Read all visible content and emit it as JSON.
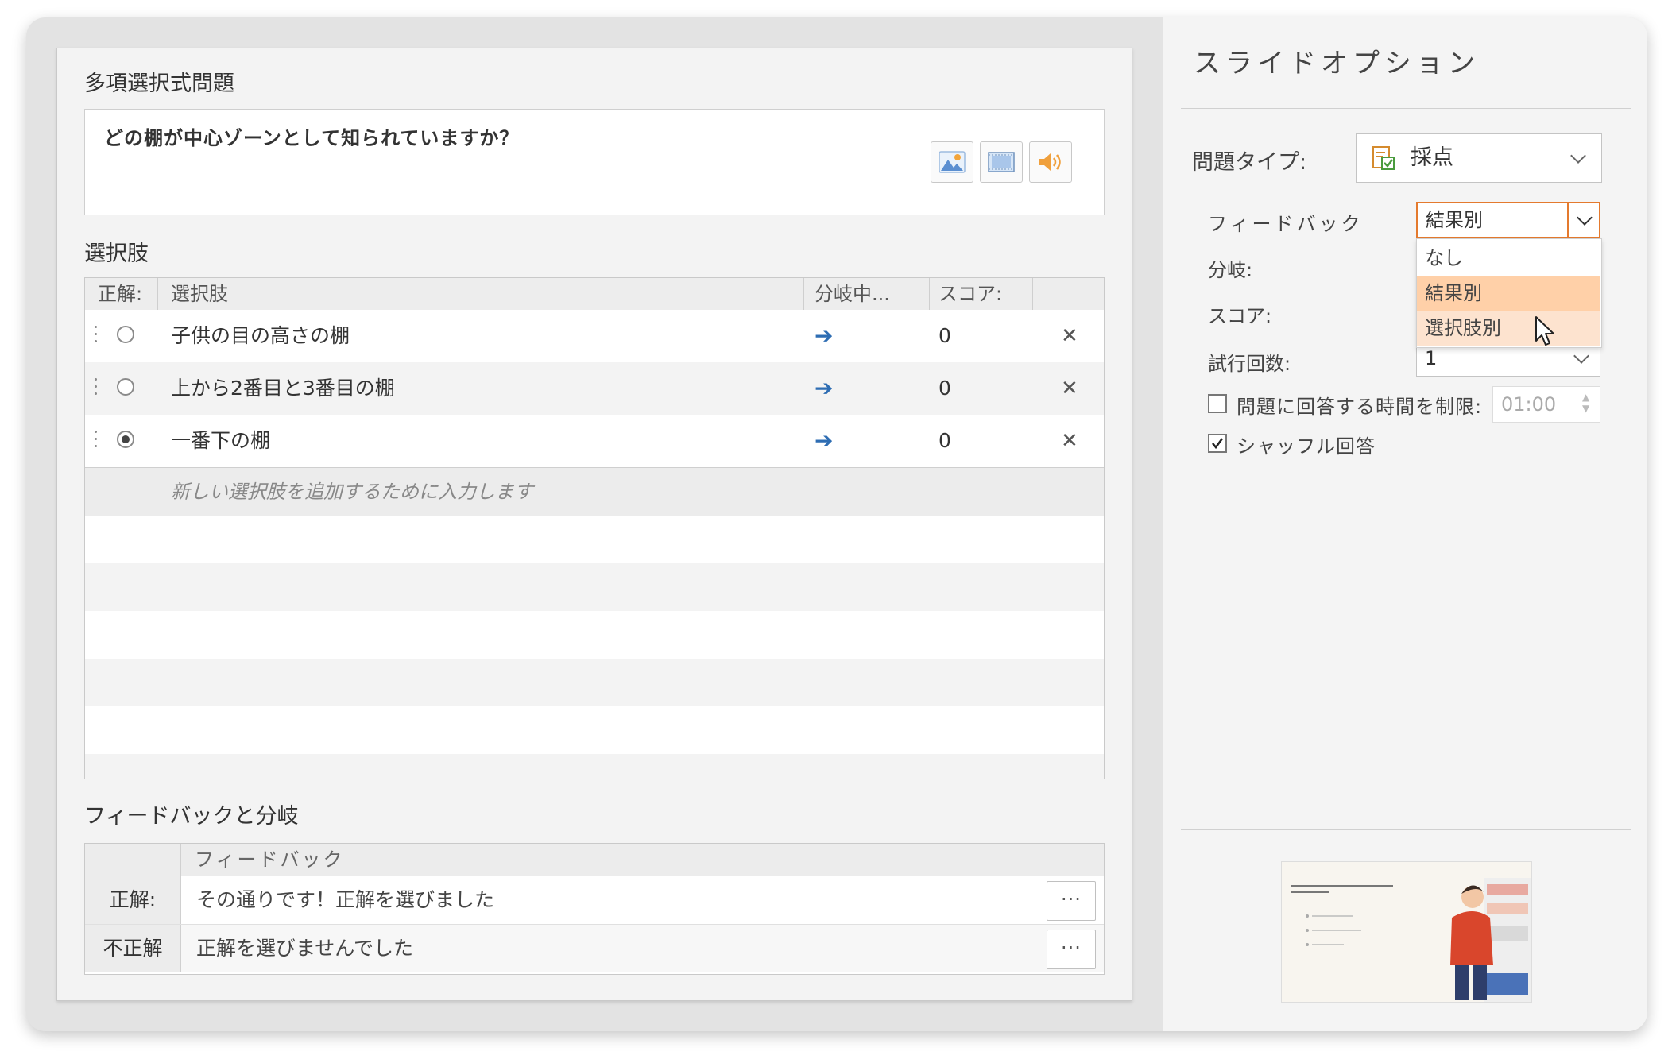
{
  "editor": {
    "question_section_label": "多項選択式問題",
    "question_text": "どの棚が中心ゾーンとして知られていますか？",
    "media_buttons": [
      {
        "icon": "image-icon"
      },
      {
        "icon": "video-icon"
      },
      {
        "icon": "audio-icon"
      }
    ],
    "choices_section_label": "選択肢",
    "choices_table": {
      "headers": {
        "correct": "正解:",
        "choice": "選択肢",
        "branch": "分岐中...",
        "score": "スコア:"
      },
      "rows": [
        {
          "text": "子供の目の高さの棚",
          "selected": false,
          "score": "0"
        },
        {
          "text": "上から2番目と3番目の棚",
          "selected": false,
          "score": "0"
        },
        {
          "text": "一番下の棚",
          "selected": true,
          "score": "0"
        }
      ],
      "add_placeholder": "新しい選択肢を追加するために入力します"
    },
    "feedback_section_label": "フィードバックと分岐",
    "feedback_table": {
      "header": "フィードバック",
      "rows": [
        {
          "label": "正解:",
          "text": "その通りです！正解を選びました"
        },
        {
          "label": "不正解",
          "text": "正解を選びませんでした"
        }
      ],
      "more_label": "···"
    }
  },
  "slide_options": {
    "title": "スライドオプション",
    "question_type_label": "問題タイプ:",
    "question_type_value": "採点",
    "feedback_label": "フィードバック",
    "feedback_value": "結果別",
    "feedback_options": [
      "なし",
      "結果別",
      "選択肢別"
    ],
    "feedback_selected_option": "結果別",
    "feedback_hovered_option": "選択肢別",
    "branch_label": "分岐:",
    "score_label": "スコア:",
    "attempts_label": "試行回数:",
    "attempts_value": "1",
    "time_limit_label": "問題に回答する時間を制限:",
    "time_limit_checked": false,
    "time_limit_value": "01:00",
    "shuffle_label": "シャッフル回答",
    "shuffle_checked": true
  },
  "colors": {
    "accent_orange": "#e47a2e",
    "selected_item": "#ffd0a8",
    "hover_item": "#fde3cf",
    "branch_arrow": "#2e6db3"
  }
}
